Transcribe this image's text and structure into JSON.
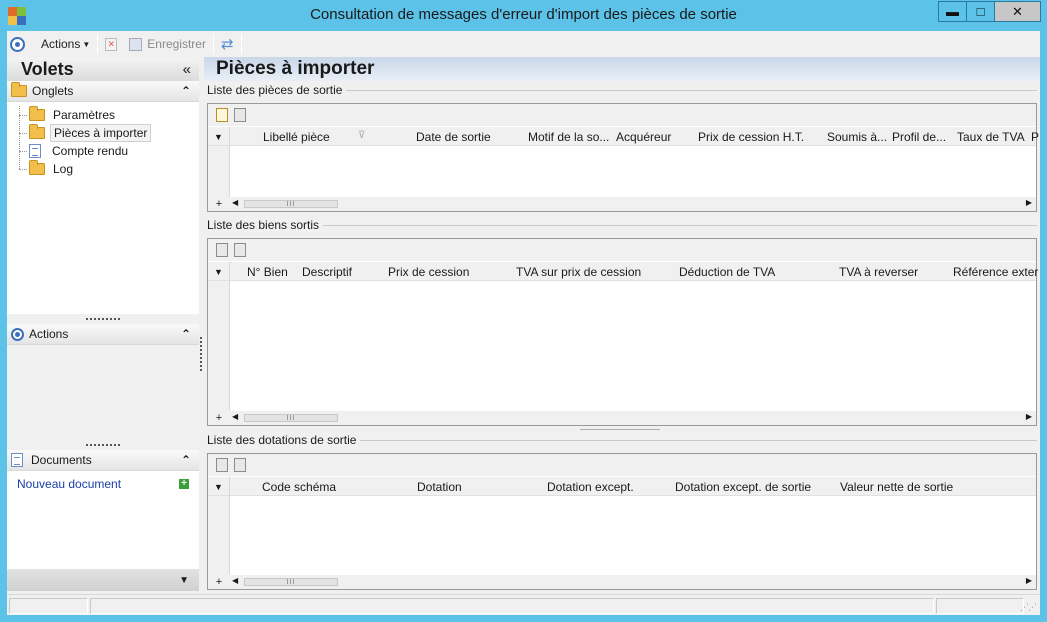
{
  "window": {
    "title": "Consultation de messages d'erreur d'import des pièces de sortie",
    "minimize": "▬",
    "maximize": "□",
    "close": "✕"
  },
  "toolbar": {
    "actions_label": "Actions",
    "save_label": "Enregistrer"
  },
  "left_panel": {
    "title": "Volets",
    "collapse_glyph": "«",
    "onglets": {
      "title": "Onglets",
      "items": [
        {
          "label": "Paramètres",
          "icon": "folder-icon"
        },
        {
          "label": "Pièces à importer",
          "icon": "folder-open-icon",
          "selected": true
        },
        {
          "label": "Compte rendu",
          "icon": "document-icon"
        },
        {
          "label": "Log",
          "icon": "folder-icon"
        }
      ]
    },
    "actions": {
      "title": "Actions"
    },
    "documents": {
      "title": "Documents",
      "new_document": "Nouveau document"
    },
    "chevron_up": "⌃",
    "chevron_down": "▼"
  },
  "main": {
    "title": "Pièces à importer",
    "groups": [
      {
        "label": "Liste des pièces de sortie",
        "columns": [
          "Libellé pièce",
          "Date de sortie",
          "Motif de la so...",
          "Acquéreur",
          "Prix de cession H.T.",
          "Soumis à...",
          "Profil de...",
          "Taux de TVA",
          "P"
        ]
      },
      {
        "label": "Liste des biens sortis",
        "columns": [
          "N° Bien",
          "Descriptif",
          "Prix de cession",
          "TVA sur prix de cession",
          "Déduction de TVA",
          "TVA à reverser",
          "Référence exter"
        ]
      },
      {
        "label": "Liste des dotations de sortie",
        "columns": [
          "Code schéma",
          "Dotation",
          "Dotation except.",
          "Dotation except. de sortie",
          "Valeur nette de sortie"
        ]
      }
    ]
  },
  "colors": {
    "title_bar": "#5cc2e8",
    "accent_blue": "#3a6fbf",
    "link": "#1a3fa5"
  }
}
